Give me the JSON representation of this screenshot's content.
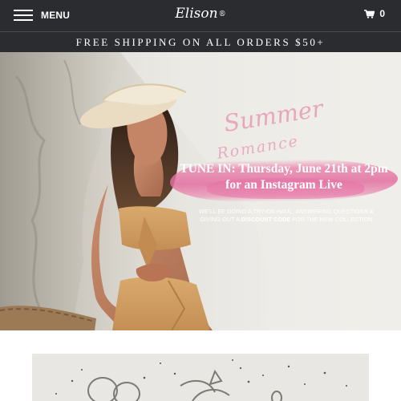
{
  "header": {
    "menu_label": "MENU",
    "logo_text": "Elison",
    "logo_mark": "®",
    "cart_count": "0",
    "icons": [
      "hamburger-icon",
      "cart-icon"
    ],
    "background": "#2a2c30"
  },
  "announcement": {
    "text": "FREE SHIPPING ON ALL ORDERS $50+"
  },
  "hero": {
    "script_title": "Summer",
    "script_subtitle": "Romance",
    "headline_line1": "TUNE IN: Thursday, June 21th at 2pm",
    "headline_line2": "for an Instagram Live",
    "note_line1": "WE'LL BE DOING A TRY-ON HAUL, ANSWERING QUESTIONS &",
    "note_prefix": "GIVING OUT A ",
    "note_bold": "DISCOUNT CODE",
    "note_suffix": " FOR THE NEW COLLECTION",
    "accent_color": "#e8a6bf"
  }
}
